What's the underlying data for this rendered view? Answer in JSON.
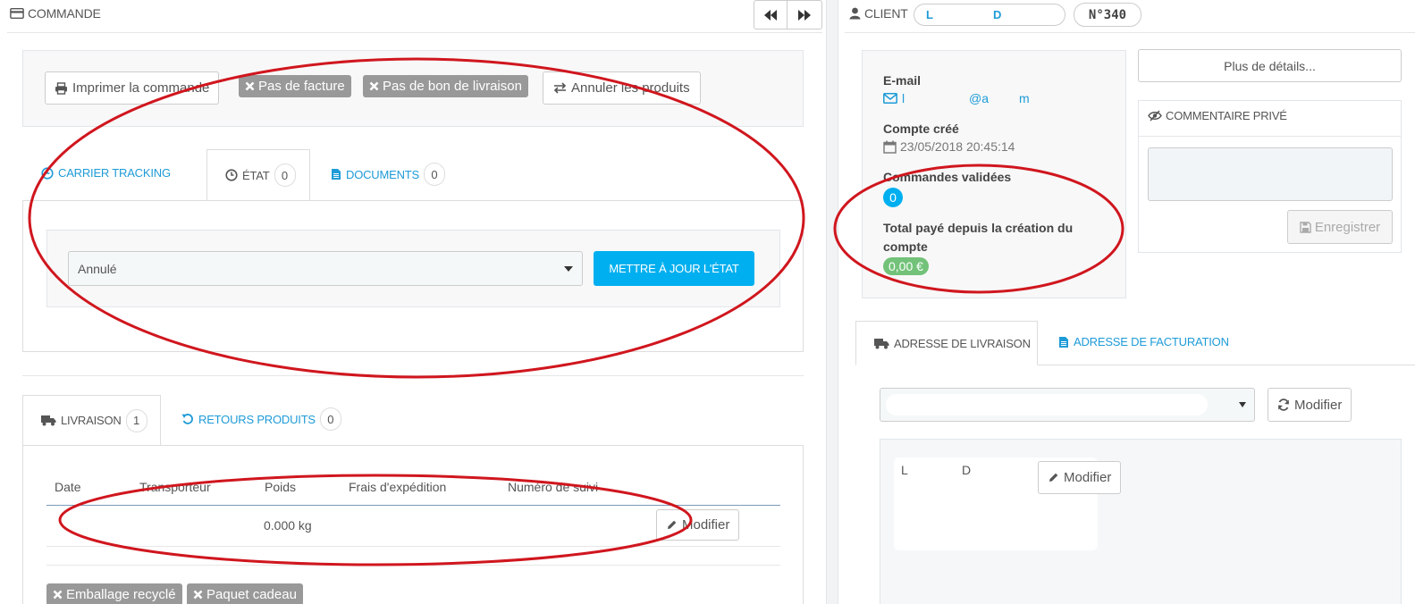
{
  "order_header": {
    "title": "COMMANDE",
    "prev_icon": "fast-backward-icon",
    "next_icon": "fast-forward-icon"
  },
  "actions": {
    "print": "Imprimer la commande",
    "no_invoice": "Pas de facture",
    "no_delivery_slip": "Pas de bon de livraison",
    "cancel_products": "Annuler les produits"
  },
  "status_tabs": {
    "tracking": "CARRIER TRACKING",
    "state": "ÉTAT",
    "state_count": "0",
    "documents": "DOCUMENTS",
    "documents_count": "0"
  },
  "state_form": {
    "selected": "Annulé",
    "update_button": "METTRE À JOUR L'ÉTAT"
  },
  "shipping_tabs": {
    "delivery": "LIVRAISON",
    "delivery_count": "1",
    "returns": "RETOURS PRODUITS",
    "returns_count": "0"
  },
  "shipping_table": {
    "headers": [
      "Date",
      "Transporteur",
      "Poids",
      "Frais d'expédition",
      "Numéro de suivi"
    ],
    "row": {
      "weight": "0.000 kg",
      "edit": "Modifier"
    }
  },
  "gift_labels": {
    "recycled": "Emballage recyclé",
    "gift": "Paquet cadeau"
  },
  "client": {
    "title": "CLIENT",
    "name_first": "L",
    "name_last": "D",
    "order_number": "N°340",
    "email_label": "E-mail",
    "email_a": "l",
    "email_b": "@a",
    "email_c": "m",
    "created_label": "Compte créé",
    "created_value": "23/05/2018 20:45:14",
    "validated_label": "Commandes validées",
    "validated_value": "0",
    "total_label_1": "Total payé depuis la création du",
    "total_label_2": "compte",
    "total_value": "0,00 €"
  },
  "more_details": "Plus de détails...",
  "private_comment": {
    "title": "COMMENTAIRE PRIVÉ",
    "save": "Enregistrer"
  },
  "address_tabs": {
    "delivery": "ADRESSE DE LIVRAISON",
    "invoice": "ADRESSE DE FACTURATION"
  },
  "address": {
    "edit": "Modifier",
    "edit2": "Modifier",
    "line_first": "L",
    "line_last": "D"
  },
  "colors": {
    "accent": "#00aff0",
    "link": "#1e9bd7",
    "label_gray": "#999999",
    "success": "#72c279",
    "annotation": "#d0161e"
  }
}
